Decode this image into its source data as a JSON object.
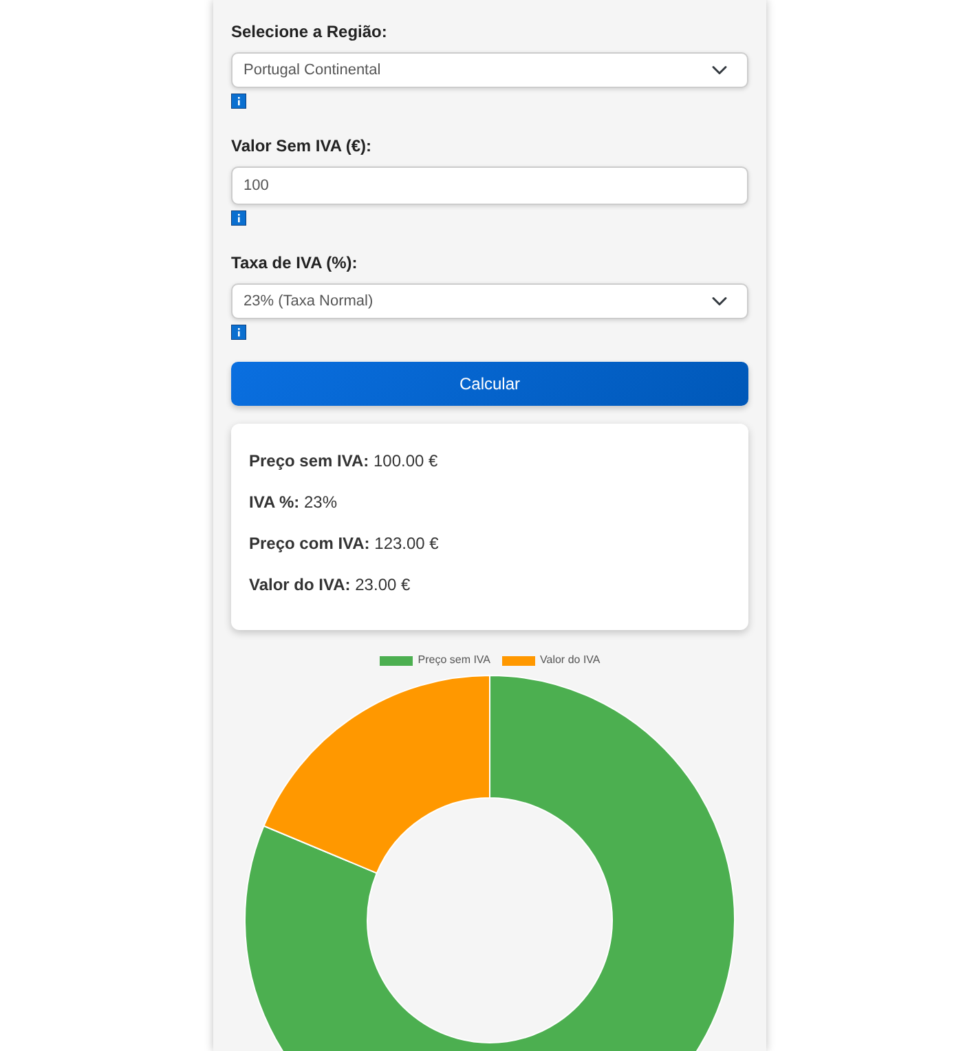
{
  "form": {
    "fields": [
      {
        "kind": "select",
        "label": "Selecione a Região:",
        "value": "Portugal Continental"
      },
      {
        "kind": "input",
        "label": "Valor Sem IVA (€):",
        "value": "100"
      },
      {
        "kind": "select",
        "label": "Taxa de IVA (%):",
        "value": "23% (Taxa Normal)"
      }
    ],
    "button": "Calcular"
  },
  "results": [
    {
      "label": "Preço sem IVA:",
      "value": "100.00 €"
    },
    {
      "label": "IVA %:",
      "value": "23%"
    },
    {
      "label": "Preço com IVA:",
      "value": "123.00 €"
    },
    {
      "label": "Valor do IVA:",
      "value": "23.00 €"
    }
  ],
  "chart": {
    "chart_data": {
      "type": "donut",
      "categories": [
        "Preço sem IVA",
        "Valor do IVA"
      ],
      "values": [
        81.3,
        18.7
      ],
      "legend": "top",
      "colors": [
        "#4caf50",
        "#ff9800"
      ]
    }
  }
}
